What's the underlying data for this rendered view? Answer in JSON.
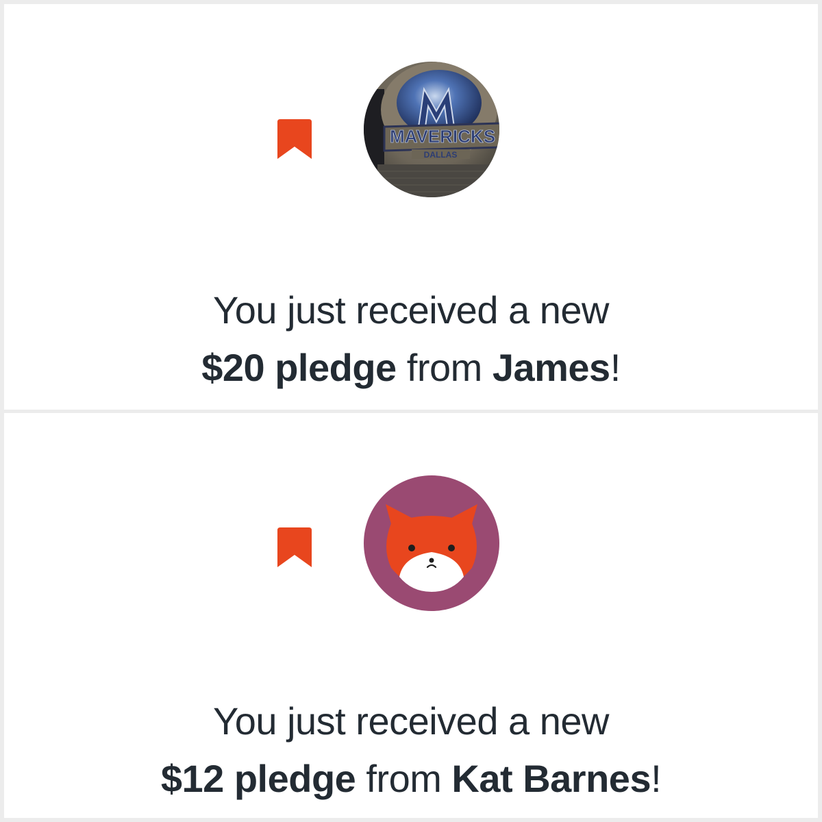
{
  "colors": {
    "page_bg": "#ececec",
    "card_bg": "#ffffff",
    "text": "#232b33",
    "bookmark": "#e8461e",
    "avatar_purple": "#9a4a72",
    "fox_orange": "#e8461e"
  },
  "notifications": [
    {
      "icon": "bookmark-icon",
      "avatar": "mavericks-cap-photo",
      "line1": "You just received a new",
      "amount": "$20 pledge",
      "from_word": " from ",
      "name": "James",
      "end": "!"
    },
    {
      "icon": "bookmark-icon",
      "avatar": "fox-avatar",
      "line1": "You just received a new",
      "amount": "$12 pledge",
      "from_word": " from ",
      "name": "Kat Barnes",
      "end": "!"
    }
  ],
  "avatar_texts": {
    "cap_logo_main": "MAVERICKS",
    "cap_logo_sub": "DALLAS"
  }
}
